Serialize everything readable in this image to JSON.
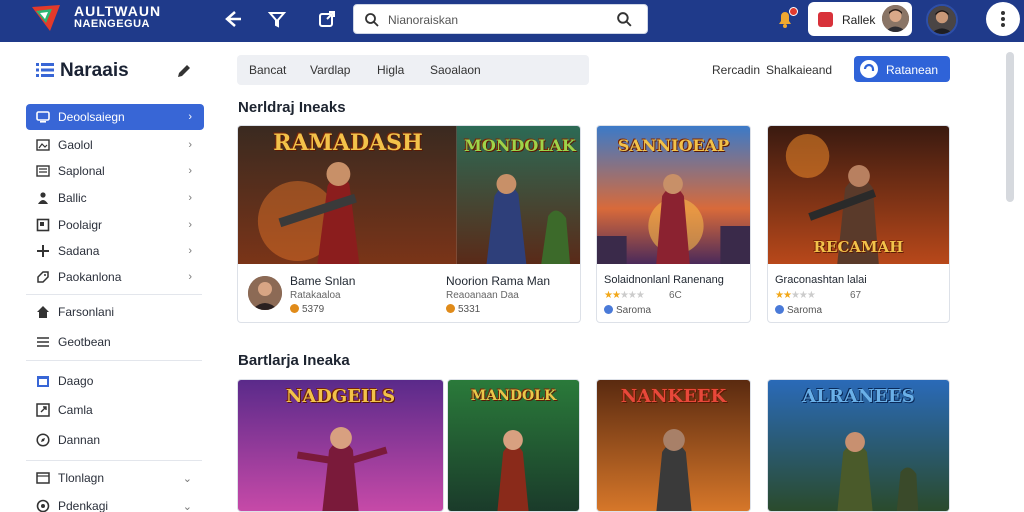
{
  "app": {
    "logo_line1": "AULTWAUN",
    "logo_line2": "NAENGEGUA"
  },
  "search": {
    "placeholder": "Nianoraiskan"
  },
  "header": {
    "user_name": "Rallek"
  },
  "sidebar": {
    "title": "Naraais",
    "items": [
      {
        "label": "Deoolsaiegn",
        "icon": "monitor-icon"
      },
      {
        "label": "Gaolol",
        "icon": "image-icon"
      },
      {
        "label": "Saplonal",
        "icon": "list-icon"
      },
      {
        "label": "Ballic",
        "icon": "person-icon"
      },
      {
        "label": "Poolaigr",
        "icon": "square-icon"
      },
      {
        "label": "Sadana",
        "icon": "plus-icon"
      },
      {
        "label": "Paokanlona",
        "icon": "tag-icon"
      },
      {
        "label": "Farsonlani",
        "icon": "home-icon"
      },
      {
        "label": "Geotbean",
        "icon": "menu-icon"
      },
      {
        "label": "Daago",
        "icon": "calendar-icon"
      },
      {
        "label": "Camla",
        "icon": "external-icon"
      },
      {
        "label": "Dannan",
        "icon": "compass-icon"
      },
      {
        "label": "Tlonlagn",
        "icon": "box-icon"
      },
      {
        "label": "Pdenkagi",
        "icon": "circle-icon"
      }
    ]
  },
  "tabs": [
    "Bancat",
    "Vardlap",
    "Higla",
    "Saoalaon"
  ],
  "toolbar": {
    "sort_a": "Rercadin",
    "sort_b": "Shalkaieand",
    "primary": "Ratanean"
  },
  "sections": [
    {
      "title": "Nerldraj Ineaks"
    },
    {
      "title": "Bartlarja Ineaka"
    }
  ],
  "cards_row1": [
    {
      "art_title": "RAMADASH",
      "title": "Bame Snlan",
      "subtitle": "Ratakaaloa",
      "price": "5379"
    },
    {
      "art_title": "MONDOLAK",
      "title": "Noorion Rama Man",
      "subtitle": "Reaoanaan Daa",
      "price": "5331"
    },
    {
      "art_title": "SANNIOEAP",
      "title": "Solaidnonlanl Ranenang",
      "subtitle": "Saroma",
      "price": "6C",
      "rating": 2.5
    },
    {
      "art_title": "RECAMAH",
      "title": "Graconashtan lalai",
      "subtitle": "Saroma",
      "price": "67",
      "rating": 2.5
    }
  ],
  "cards_row2": [
    {
      "art_title": "NADGEILS"
    },
    {
      "art_title": "MANDOLK"
    },
    {
      "art_title": "NANKEEK"
    },
    {
      "art_title": "ALRANEES"
    }
  ],
  "colors": {
    "topbar": "#1f3a8a",
    "accent": "#3866d6",
    "primary_button": "#2f63d8"
  }
}
